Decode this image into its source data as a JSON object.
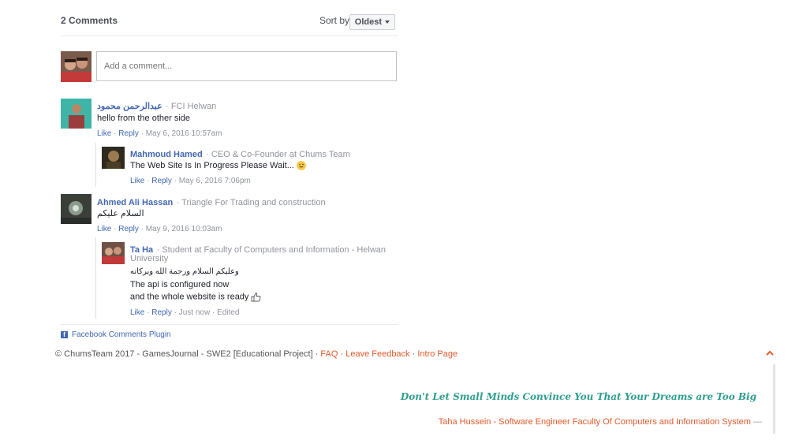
{
  "header": {
    "count": "2 Comments",
    "sort_label": "Sort by",
    "sort_value": "Oldest"
  },
  "composer": {
    "placeholder": "Add a comment..."
  },
  "comments": [
    {
      "name": "عبدالرحمن محمود",
      "meta": "· FCI Helwan",
      "text": "hello from the other side",
      "like": "Like",
      "reply": "Reply",
      "time": "· May 6, 2016 10:57am"
    },
    {
      "name": "Mahmoud Hamed",
      "meta": "· CEO & Co-Founder at Chums Team",
      "text": "The Web Site Is In Progress Please Wait...",
      "like": "Like",
      "reply": "Reply",
      "time": "· May 6, 2016 7:06pm"
    },
    {
      "name": "Ahmed Ali Hassan",
      "meta": "· Triangle For Trading and construction",
      "text": "السلام عليكم",
      "like": "Like",
      "reply": "Reply",
      "time": "· May 9, 2016 10:03am"
    },
    {
      "name": "Ta Ha",
      "meta": "· Student at Faculty of Computers and Information - Helwan",
      "meta2": "University",
      "line1": "وعليكم السلام ورحمة الله وبركاته",
      "line2": "The api is configured now",
      "line3": "and the whole website is ready",
      "like": "Like",
      "reply": "Reply",
      "time": "· Just now · Edited"
    }
  ],
  "plugin": {
    "label": "Facebook Comments Plugin"
  },
  "footer": {
    "copy": "© ChumsTeam 2017 - GamesJournal - SWE2 [Educational Project] · ",
    "faq": "FAQ",
    "sep1": " · ",
    "feedback": "Leave Feedback",
    "sep2": " · ",
    "intro": "Intro Page"
  },
  "quote": "Don't Let Small Minds Convince You That Your Dreams are Too Big",
  "signature": {
    "text": "Taha Hussein - Software Engineer Faculty Of Computers and Information System",
    "dash": " —"
  },
  "colors": {
    "link": "#4267b2",
    "accent": "#e05a2b",
    "quote": "#2e9e8f"
  }
}
